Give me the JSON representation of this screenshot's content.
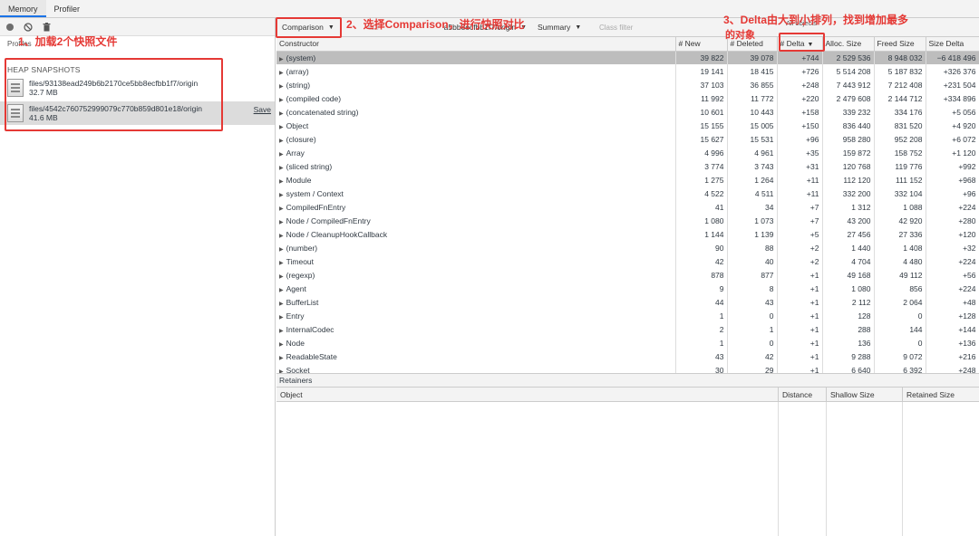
{
  "tabs": [
    "Memory",
    "Profiler"
  ],
  "sidebar": {
    "profiles_label": "Profiles",
    "heap_title": "HEAP SNAPSHOTS",
    "snapshots": [
      {
        "path": "files/93138ead249b6b2170ce5bb8ecfbb1f7/origin",
        "size": "32.7 MB"
      },
      {
        "path": "files/4542c760752999079c770b859d801e18/origin",
        "size": "41.6 MB",
        "save": "Save"
      }
    ]
  },
  "toolbar": {
    "view": "Comparison",
    "base_partial": "413",
    "base_snapshot": "a5bb8ecfbb1f7/origin",
    "perspective": "Summary",
    "class_filter_placeholder": "Class filter",
    "all_objects": "All objects"
  },
  "table": {
    "columns": [
      "Constructor",
      "# New",
      "# Deleted",
      "# Delta",
      "Alloc. Size",
      "Freed Size",
      "Size Delta"
    ],
    "rows": [
      [
        "(system)",
        "39 822",
        "39 078",
        "+744",
        "2 529 536",
        "8 948 032",
        "−6 418 496"
      ],
      [
        "(array)",
        "19 141",
        "18 415",
        "+726",
        "5 514 208",
        "5 187 832",
        "+326 376"
      ],
      [
        "(string)",
        "37 103",
        "36 855",
        "+248",
        "7 443 912",
        "7 212 408",
        "+231 504"
      ],
      [
        "(compiled code)",
        "11 992",
        "11 772",
        "+220",
        "2 479 608",
        "2 144 712",
        "+334 896"
      ],
      [
        "(concatenated string)",
        "10 601",
        "10 443",
        "+158",
        "339 232",
        "334 176",
        "+5 056"
      ],
      [
        "Object",
        "15 155",
        "15 005",
        "+150",
        "836 440",
        "831 520",
        "+4 920"
      ],
      [
        "(closure)",
        "15 627",
        "15 531",
        "+96",
        "958 280",
        "952 208",
        "+6 072"
      ],
      [
        "Array",
        "4 996",
        "4 961",
        "+35",
        "159 872",
        "158 752",
        "+1 120"
      ],
      [
        "(sliced string)",
        "3 774",
        "3 743",
        "+31",
        "120 768",
        "119 776",
        "+992"
      ],
      [
        "Module",
        "1 275",
        "1 264",
        "+11",
        "112 120",
        "111 152",
        "+968"
      ],
      [
        "system / Context",
        "4 522",
        "4 511",
        "+11",
        "332 200",
        "332 104",
        "+96"
      ],
      [
        "CompiledFnEntry",
        "41",
        "34",
        "+7",
        "1 312",
        "1 088",
        "+224"
      ],
      [
        "Node / CompiledFnEntry",
        "1 080",
        "1 073",
        "+7",
        "43 200",
        "42 920",
        "+280"
      ],
      [
        "Node / CleanupHookCallback",
        "1 144",
        "1 139",
        "+5",
        "27 456",
        "27 336",
        "+120"
      ],
      [
        "(number)",
        "90",
        "88",
        "+2",
        "1 440",
        "1 408",
        "+32"
      ],
      [
        "Timeout",
        "42",
        "40",
        "+2",
        "4 704",
        "4 480",
        "+224"
      ],
      [
        "(regexp)",
        "878",
        "877",
        "+1",
        "49 168",
        "49 112",
        "+56"
      ],
      [
        "Agent",
        "9",
        "8",
        "+1",
        "1 080",
        "856",
        "+224"
      ],
      [
        "BufferList",
        "44",
        "43",
        "+1",
        "2 112",
        "2 064",
        "+48"
      ],
      [
        "Entry",
        "1",
        "0",
        "+1",
        "128",
        "0",
        "+128"
      ],
      [
        "InternalCodec",
        "2",
        "1",
        "+1",
        "288",
        "144",
        "+144"
      ],
      [
        "Node",
        "1",
        "0",
        "+1",
        "136",
        "0",
        "+136"
      ],
      [
        "ReadableState",
        "43",
        "42",
        "+1",
        "9 288",
        "9 072",
        "+216"
      ],
      [
        "Socket",
        "30",
        "29",
        "+1",
        "6 640",
        "6 392",
        "+248"
      ]
    ]
  },
  "retainers": {
    "title": "Retainers",
    "columns": [
      "Object",
      "Distance",
      "Shallow Size",
      "Retained Size"
    ]
  },
  "annotations": {
    "a1": "1、加载2个快照文件",
    "a2": "2、选择Comparison，进行快照对比",
    "a3_line1": "3、Delta由大到小排列，找到增加最多",
    "a3_line2": "的对象"
  },
  "colors": {
    "annotation": "#e53935",
    "selected_row": "#bdbdbd"
  }
}
